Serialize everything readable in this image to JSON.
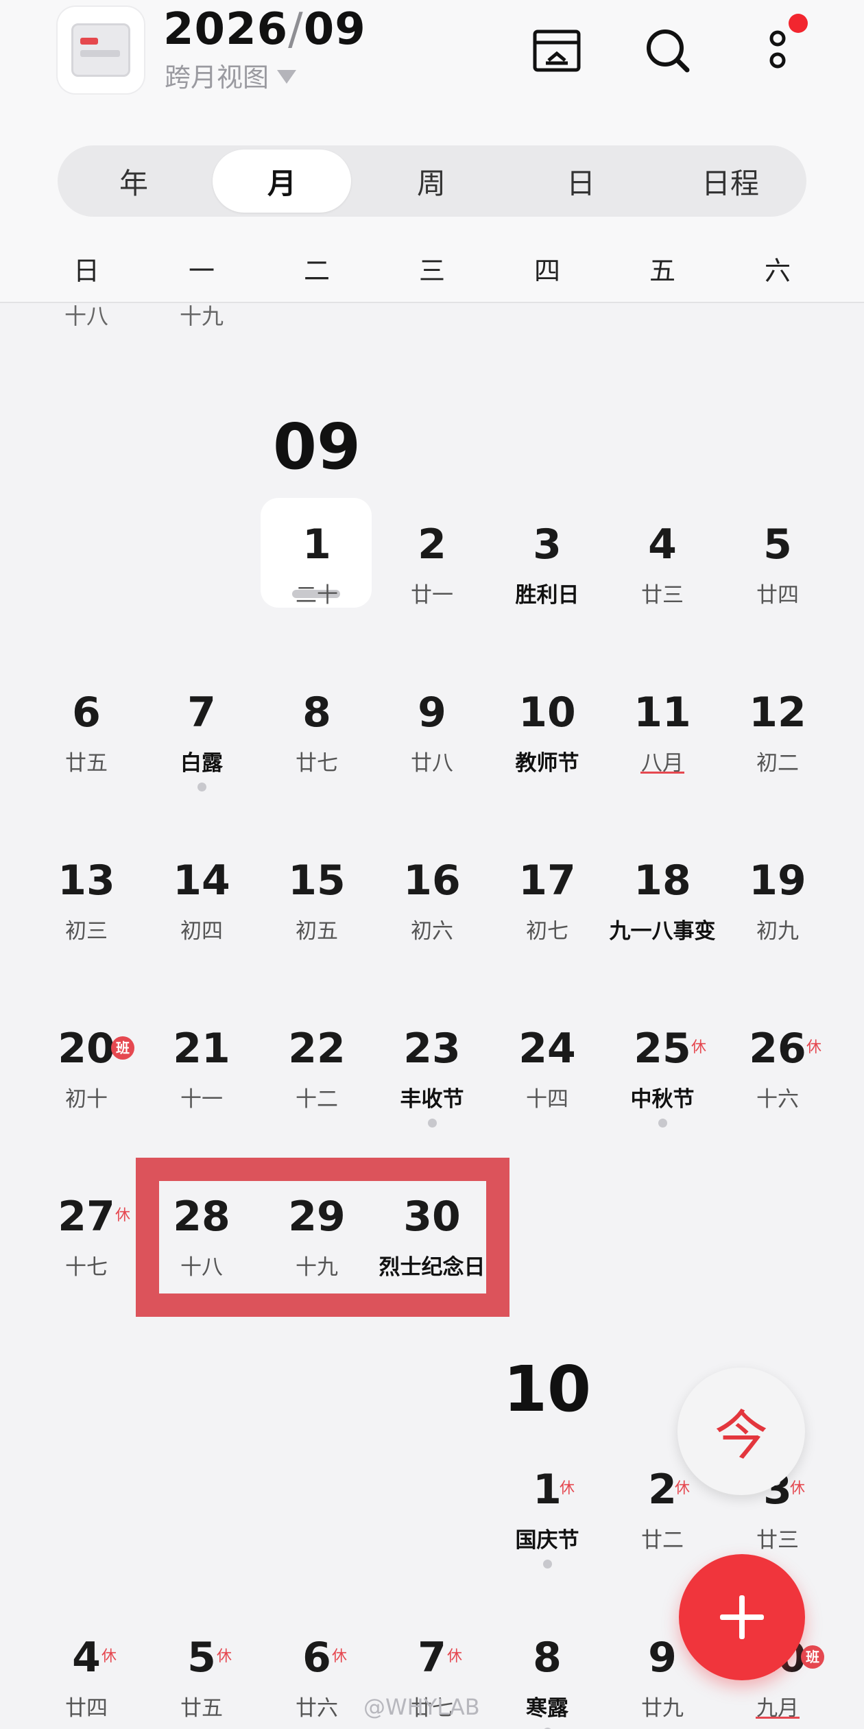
{
  "header": {
    "year": "2026",
    "slash": "/",
    "month": "09",
    "view_mode": "跨月视图",
    "icons": [
      "archive-icon",
      "search-icon",
      "more-icon"
    ]
  },
  "tabs": [
    "年",
    "月",
    "周",
    "日",
    "日程"
  ],
  "active_tab": "月",
  "weekdays": [
    "日",
    "一",
    "二",
    "三",
    "四",
    "五",
    "六"
  ],
  "prev_month_tail": [
    "十八",
    "十九"
  ],
  "month_label_sep": "09",
  "month_label_oct": "10",
  "september": {
    "d1": {
      "num": "1",
      "sub": "二十"
    },
    "d2": {
      "num": "2",
      "sub": "廿一"
    },
    "d3": {
      "num": "3",
      "sub": "胜利日"
    },
    "d4": {
      "num": "4",
      "sub": "廿三"
    },
    "d5": {
      "num": "5",
      "sub": "廿四"
    },
    "d6": {
      "num": "6",
      "sub": "廿五"
    },
    "d7": {
      "num": "7",
      "sub": "白露"
    },
    "d8": {
      "num": "8",
      "sub": "廿七"
    },
    "d9": {
      "num": "9",
      "sub": "廿八"
    },
    "d10": {
      "num": "10",
      "sub": "教师节"
    },
    "d11": {
      "num": "11",
      "sub": "八月"
    },
    "d12": {
      "num": "12",
      "sub": "初二"
    },
    "d13": {
      "num": "13",
      "sub": "初三"
    },
    "d14": {
      "num": "14",
      "sub": "初四"
    },
    "d15": {
      "num": "15",
      "sub": "初五"
    },
    "d16": {
      "num": "16",
      "sub": "初六"
    },
    "d17": {
      "num": "17",
      "sub": "初七"
    },
    "d18": {
      "num": "18",
      "sub": "九一八事变"
    },
    "d19": {
      "num": "19",
      "sub": "初九"
    },
    "d20": {
      "num": "20",
      "sub": "初十"
    },
    "d21": {
      "num": "21",
      "sub": "十一"
    },
    "d22": {
      "num": "22",
      "sub": "十二"
    },
    "d23": {
      "num": "23",
      "sub": "丰收节"
    },
    "d24": {
      "num": "24",
      "sub": "十四"
    },
    "d25": {
      "num": "25",
      "sub": "中秋节"
    },
    "d26": {
      "num": "26",
      "sub": "十六"
    },
    "d27": {
      "num": "27",
      "sub": "十七"
    },
    "d28": {
      "num": "28",
      "sub": "十八"
    },
    "d29": {
      "num": "29",
      "sub": "十九"
    },
    "d30": {
      "num": "30",
      "sub": "烈士纪念日"
    }
  },
  "october": {
    "d1": {
      "num": "1",
      "sub": "国庆节"
    },
    "d2": {
      "num": "2",
      "sub": "廿二"
    },
    "d3": {
      "num": "3",
      "sub": "廿三"
    },
    "d4": {
      "num": "4",
      "sub": "廿四"
    },
    "d5": {
      "num": "5",
      "sub": "廿五"
    },
    "d6": {
      "num": "6",
      "sub": "廿六"
    },
    "d7": {
      "num": "7",
      "sub": "廿七"
    },
    "d8": {
      "num": "8",
      "sub": "寒露"
    },
    "d9": {
      "num": "9",
      "sub": "廿九"
    },
    "d10": {
      "num": "10",
      "sub": "九月"
    }
  },
  "badges": {
    "rest": "休",
    "work": "班"
  },
  "fab_today": "今",
  "watermark": "@WHYLAB",
  "colors": {
    "accent": "#f0353c",
    "highlight": "#dc535b",
    "background": "#f3f3f5"
  }
}
